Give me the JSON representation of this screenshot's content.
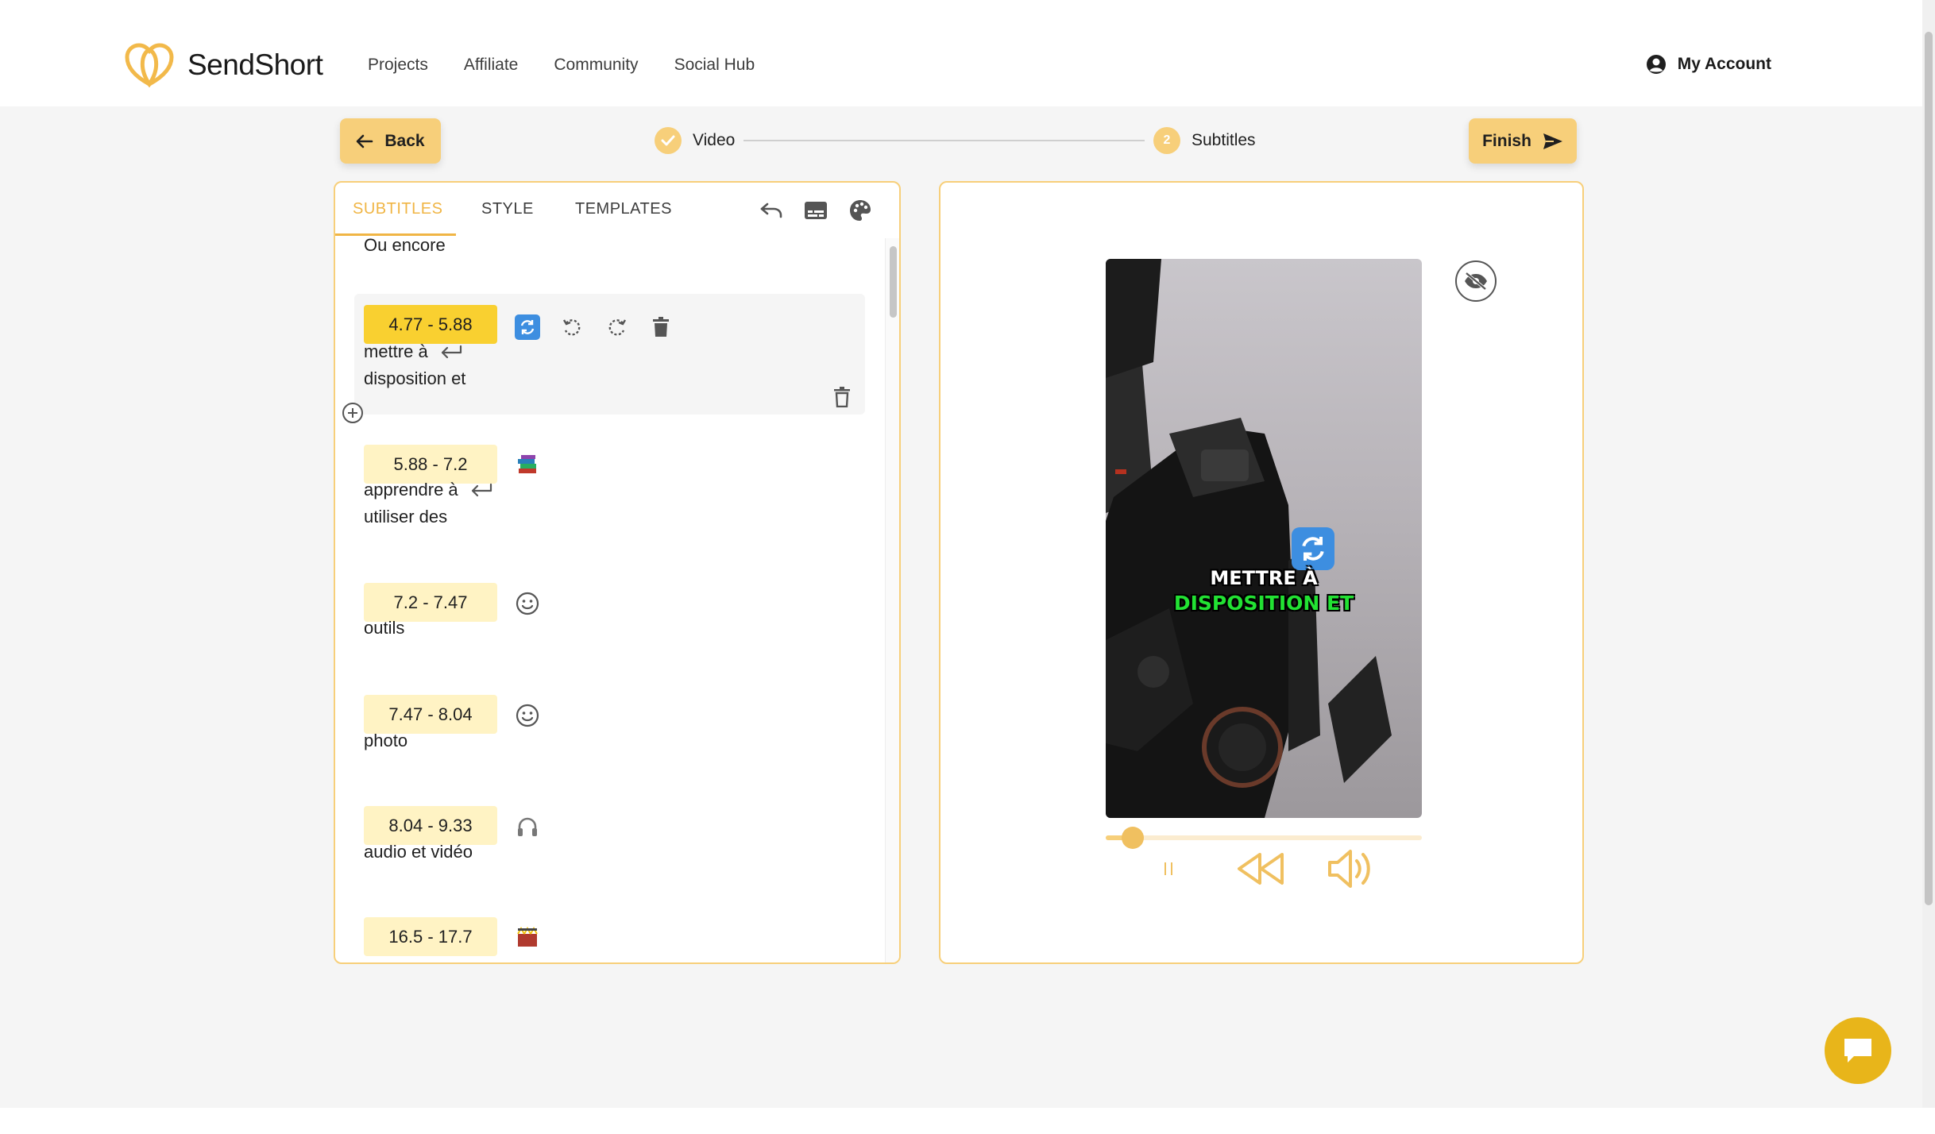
{
  "header": {
    "brand": "SendShort",
    "nav": [
      "Projects",
      "Affiliate",
      "Community",
      "Social Hub"
    ],
    "account_label": "My Account"
  },
  "stepper": {
    "back_label": "Back",
    "finish_label": "Finish",
    "steps": [
      {
        "label": "Video",
        "status": "done"
      },
      {
        "label": "Subtitles",
        "number": "2",
        "status": "current"
      }
    ]
  },
  "editor": {
    "tabs": [
      "SUBTITLES",
      "STYLE",
      "TEMPLATES"
    ],
    "active_tab": "SUBTITLES",
    "toolbar_icons": [
      "undo-icon",
      "subtitles-icon",
      "palette-icon"
    ],
    "top_partial_text": "Ou encore",
    "segments": [
      {
        "time": "4.77 - 5.88",
        "lines": [
          "mettre à",
          "disposition et"
        ],
        "emoji": "🔄",
        "selected": true,
        "line_break": true
      },
      {
        "time": "5.88 - 7.2",
        "lines": [
          "apprendre à",
          "utiliser des"
        ],
        "emoji": "📚",
        "selected": false,
        "line_break": true
      },
      {
        "time": "7.2 - 7.47",
        "lines": [
          "outils"
        ],
        "emoji": "smiley-icon",
        "selected": false
      },
      {
        "time": "7.47 - 8.04",
        "lines": [
          "photo"
        ],
        "emoji": "smiley-icon",
        "selected": false
      },
      {
        "time": "8.04 - 9.33",
        "lines": [
          "audio et vidéo"
        ],
        "emoji": "🎧",
        "selected": false
      },
      {
        "time": "16.5 - 17.7",
        "lines": [],
        "emoji": "🎬",
        "selected": false
      }
    ]
  },
  "preview": {
    "caption_line1": "METTRE À",
    "caption_line2": "DISPOSITION ET",
    "caption_emoji": "🔄",
    "progress": 0.06,
    "colors": {
      "caption_primary": "#ffffff",
      "caption_highlight": "#22e233",
      "accent": "#f7cf7a"
    }
  }
}
